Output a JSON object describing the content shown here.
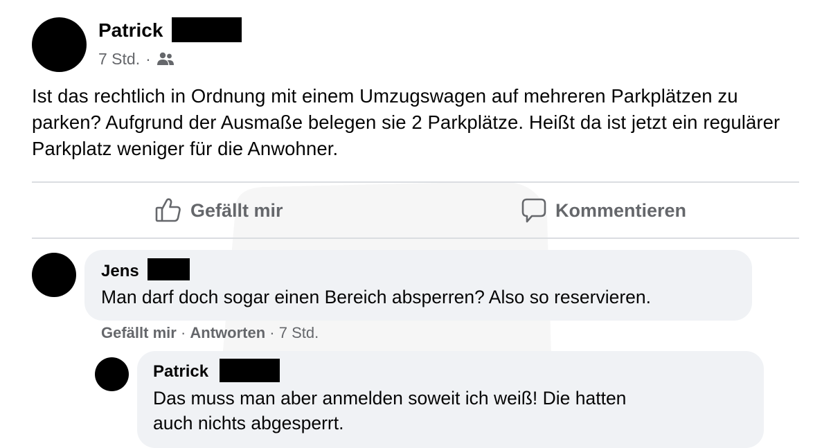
{
  "post": {
    "author": "Patrick",
    "time": "7 Std.",
    "audience_icon": "friends-icon",
    "text": "Ist das rechtlich in Ordnung mit einem Umzugswagen auf mehreren Parkplätzen zu parken? Aufgrund der Ausmaße belegen sie 2 Parkplätze. Heißt da ist jetzt ein regulärer Parkplatz weniger für die Anwohner."
  },
  "actions": {
    "like_label": "Gefällt mir",
    "like_icon": "thumbs-up-icon",
    "comment_label": "Kommentieren",
    "comment_icon": "speech-bubble-icon"
  },
  "comments": [
    {
      "author": "Jens",
      "text": "Man darf doch sogar einen Bereich absperren? Also so reservieren.",
      "like_label": "Gefällt mir",
      "reply_label": "Antworten",
      "time": "7 Std."
    },
    {
      "author": "Patrick",
      "text_line1": "Das muss man aber anmelden soweit ich weiß! Die hatten",
      "text_line2": "auch nichts abgesperrt."
    }
  ],
  "colors": {
    "text": "#050505",
    "secondary_text": "#65676b",
    "bubble": "#f0f2f5",
    "divider": "#dadde1",
    "redaction": "#000000"
  }
}
